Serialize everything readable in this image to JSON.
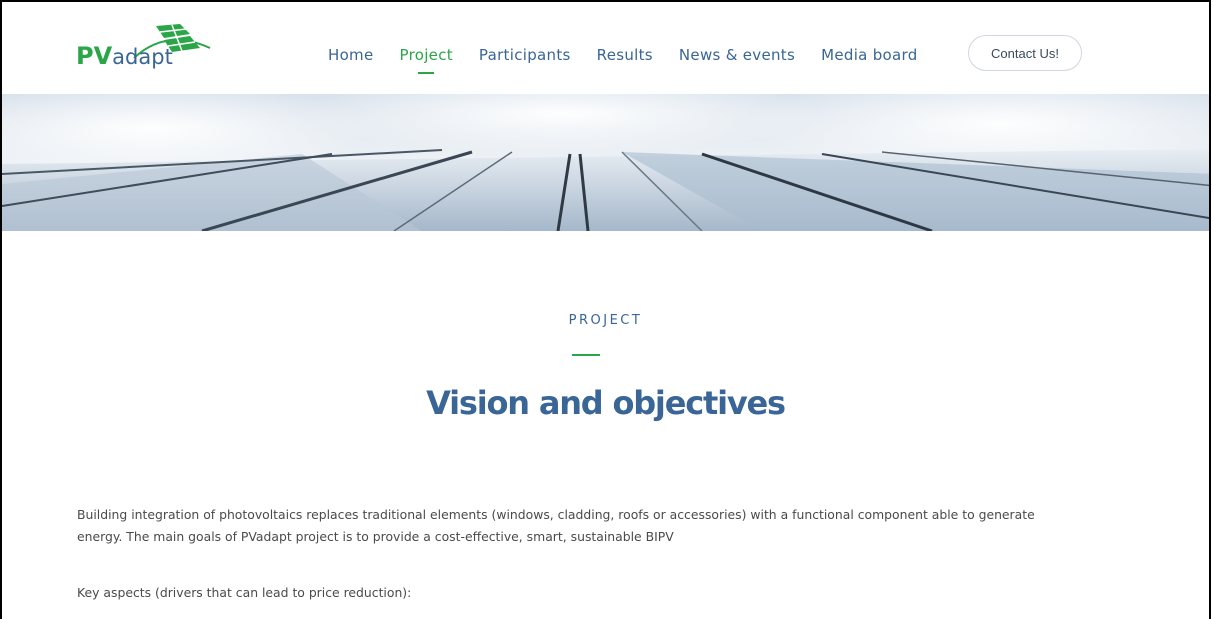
{
  "brand": {
    "logo_pv": "PV",
    "logo_adapt": "adapt",
    "logo_icon": "solar-panel-icon",
    "green": "#2aa648",
    "blue": "#3a6597"
  },
  "nav": {
    "items": [
      {
        "label": "Home",
        "active": false
      },
      {
        "label": "Project",
        "active": true
      },
      {
        "label": "Participants",
        "active": false
      },
      {
        "label": "Results",
        "active": false
      },
      {
        "label": "News & events",
        "active": false
      },
      {
        "label": "Media board",
        "active": false
      }
    ],
    "contact_label": "Contact Us!"
  },
  "main": {
    "eyebrow": "PROJECT",
    "title": "Vision and objectives",
    "paragraph1": "Building integration of photovoltaics replaces traditional elements (windows, cladding, roofs or accessories) with a functional component able to generate energy. The main goals of PVadapt project is to provide a cost-effective, smart, sustainable BIPV",
    "paragraph2": "Key aspects (drivers that can lead to price reduction):"
  }
}
